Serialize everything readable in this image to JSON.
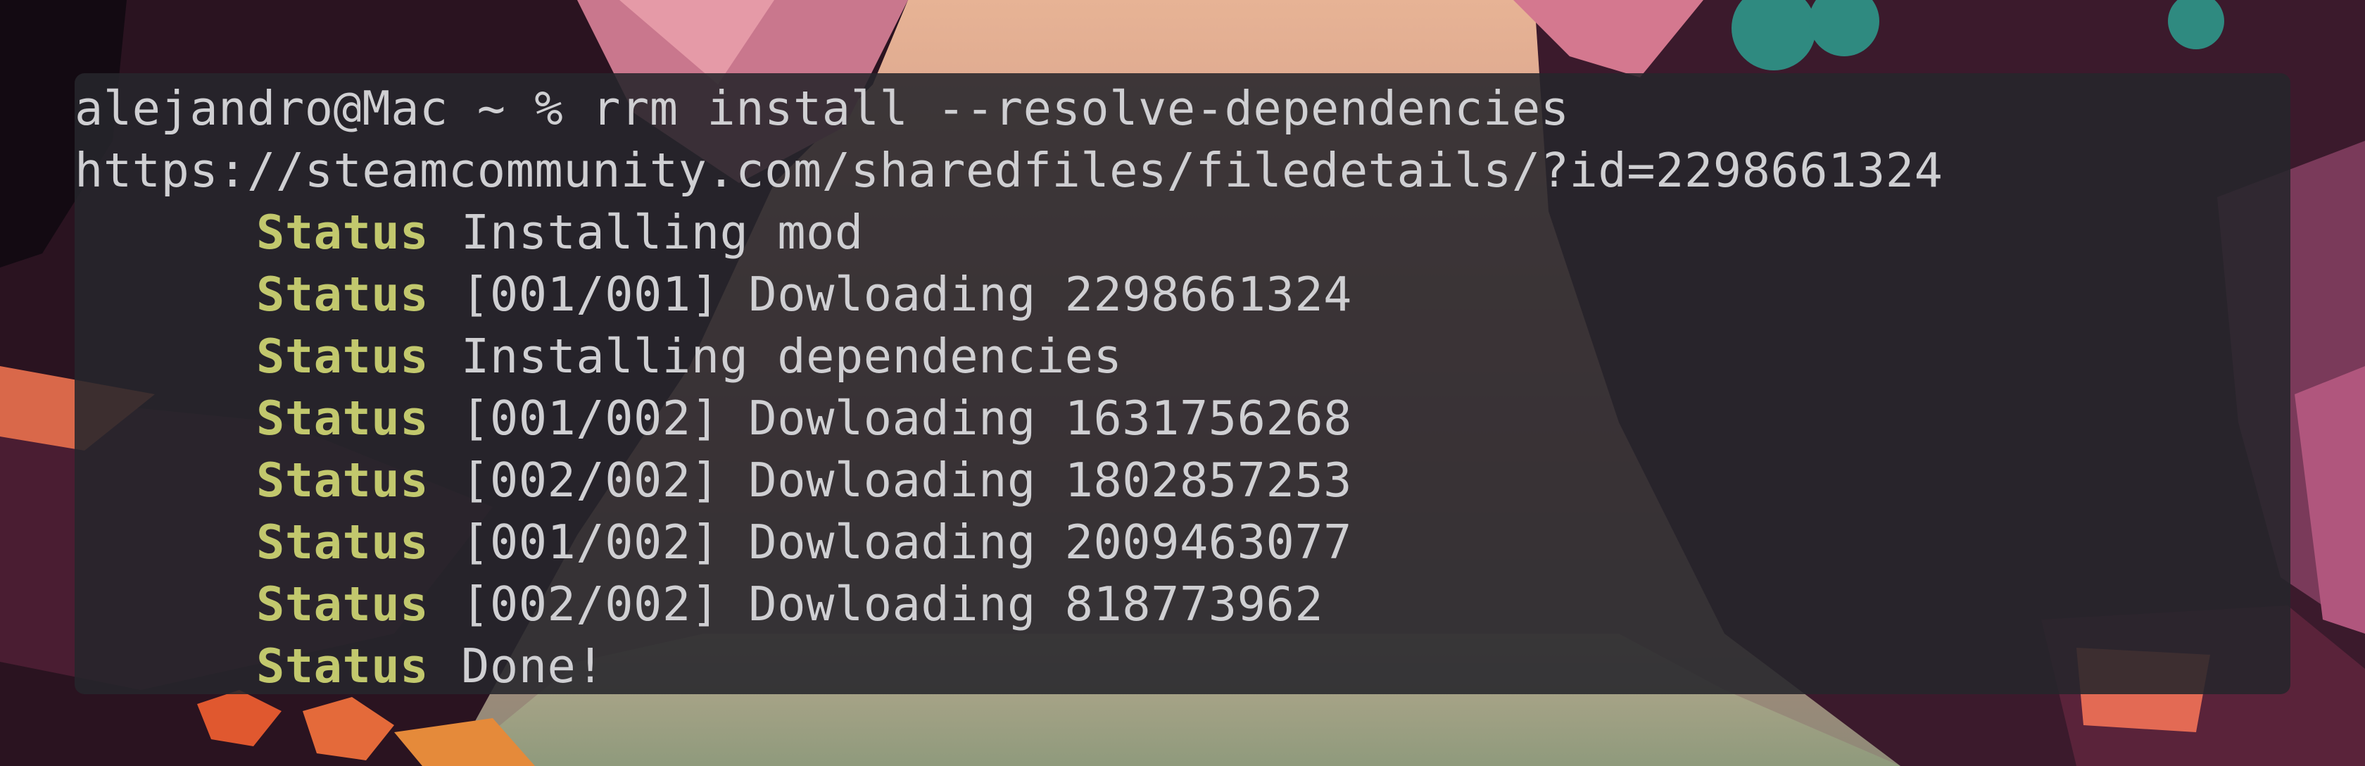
{
  "terminal": {
    "prompt": "alejandro@Mac ~ % rrm install --resolve-dependencies",
    "url": "https://steamcommunity.com/sharedfiles/filedetails/?id=2298661324",
    "status_lines": [
      {
        "label": "Status",
        "message": "Installing mod"
      },
      {
        "label": "Status",
        "message": "[001/001] Dowloading 2298661324"
      },
      {
        "label": "Status",
        "message": "Installing dependencies"
      },
      {
        "label": "Status",
        "message": "[001/002] Dowloading 1631756268"
      },
      {
        "label": "Status",
        "message": "[002/002] Dowloading 1802857253"
      },
      {
        "label": "Status",
        "message": "[001/002] Dowloading 2009463077"
      },
      {
        "label": "Status",
        "message": "[002/002] Dowloading 818773962"
      },
      {
        "label": "Status",
        "message": "Done!"
      }
    ]
  },
  "colors": {
    "terminal_background": "#26262b",
    "text": "#cfcfd2",
    "status_keyword": "#c2c86d"
  }
}
